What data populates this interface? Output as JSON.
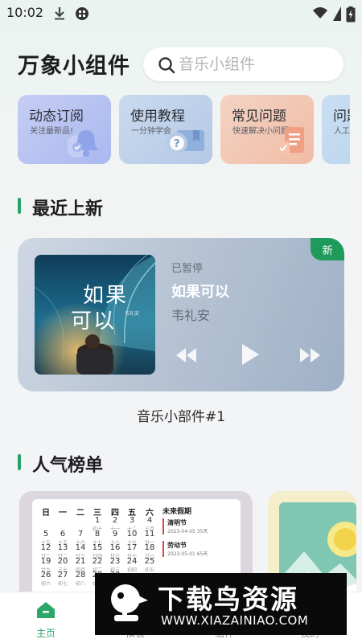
{
  "status_bar": {
    "time": "10:02"
  },
  "header": {
    "title": "万象小组件"
  },
  "search": {
    "placeholder": "音乐小组件"
  },
  "quick_cards": [
    {
      "title": "动态订阅",
      "subtitle": "关注最新品!"
    },
    {
      "title": "使用教程",
      "subtitle": "一分钟学会"
    },
    {
      "title": "常见问题",
      "subtitle": "快速解决小问题"
    },
    {
      "title": "问题",
      "subtitle": "人工"
    }
  ],
  "sections": {
    "latest": "最近上新",
    "popular": "人气榜单"
  },
  "music_widget": {
    "badge": "新",
    "album_title_line1": "如果",
    "album_title_line2": "可以",
    "album_small": "韦礼安",
    "status": "已暂停",
    "song": "如果可以",
    "artist": "韦礼安",
    "caption": "音乐小部件#1"
  },
  "calendar": {
    "weekdays": [
      "日",
      "一",
      "二",
      "三",
      "四",
      "五",
      "六"
    ],
    "rows": [
      [
        [
          "",
          ""
        ],
        [
          "",
          ""
        ],
        [
          "",
          ""
        ],
        [
          "1",
          "初十"
        ],
        [
          "2",
          "十一"
        ],
        [
          "3",
          "十二"
        ],
        [
          "4",
          "三月"
        ]
      ],
      [
        [
          "5",
          "十五"
        ],
        [
          "6",
          "十五"
        ],
        [
          "7",
          "十六"
        ],
        [
          "8",
          "十七"
        ],
        [
          "9",
          "十八"
        ],
        [
          "10",
          "十九"
        ],
        [
          "11",
          "廿一"
        ]
      ],
      [
        [
          "12",
          "廿二"
        ],
        [
          "13",
          "廿二"
        ],
        [
          "14",
          "廿三"
        ],
        [
          "15",
          "廿四"
        ],
        [
          "16",
          "廿六"
        ],
        [
          "17",
          "廿七"
        ],
        [
          "18",
          "廿八"
        ]
      ],
      [
        [
          "19",
          "廿九"
        ],
        [
          "20",
          "三十"
        ],
        [
          "21",
          "四月"
        ],
        [
          "22",
          "初二"
        ],
        [
          "23",
          "初三"
        ],
        [
          "24",
          "初四"
        ],
        [
          "25",
          "初五"
        ]
      ],
      [
        [
          "26",
          "初六"
        ],
        [
          "27",
          "初七"
        ],
        [
          "28",
          "初八"
        ],
        [
          "29",
          "初九"
        ],
        [
          "30",
          "初十"
        ],
        [
          "",
          ""
        ],
        [
          "",
          ""
        ]
      ]
    ],
    "holiday_header": "未来假期",
    "holidays": [
      {
        "name": "清明节",
        "info": "2023-04-05 35天"
      },
      {
        "name": "劳动节",
        "info": "2023-05-01 65天"
      }
    ]
  },
  "bottom_nav": [
    {
      "label": "主页",
      "active": true
    },
    {
      "label": "模板",
      "active": false
    },
    {
      "label": "组件",
      "active": false
    },
    {
      "label": "我的",
      "active": false
    }
  ],
  "watermark": {
    "brand": "下载鸟资源",
    "url": "WWW.XIAZAINIAO.COM"
  },
  "colors": {
    "accent": "#27a36a",
    "badge": "#1e9a5b",
    "nav_active": "#2aa76a"
  }
}
